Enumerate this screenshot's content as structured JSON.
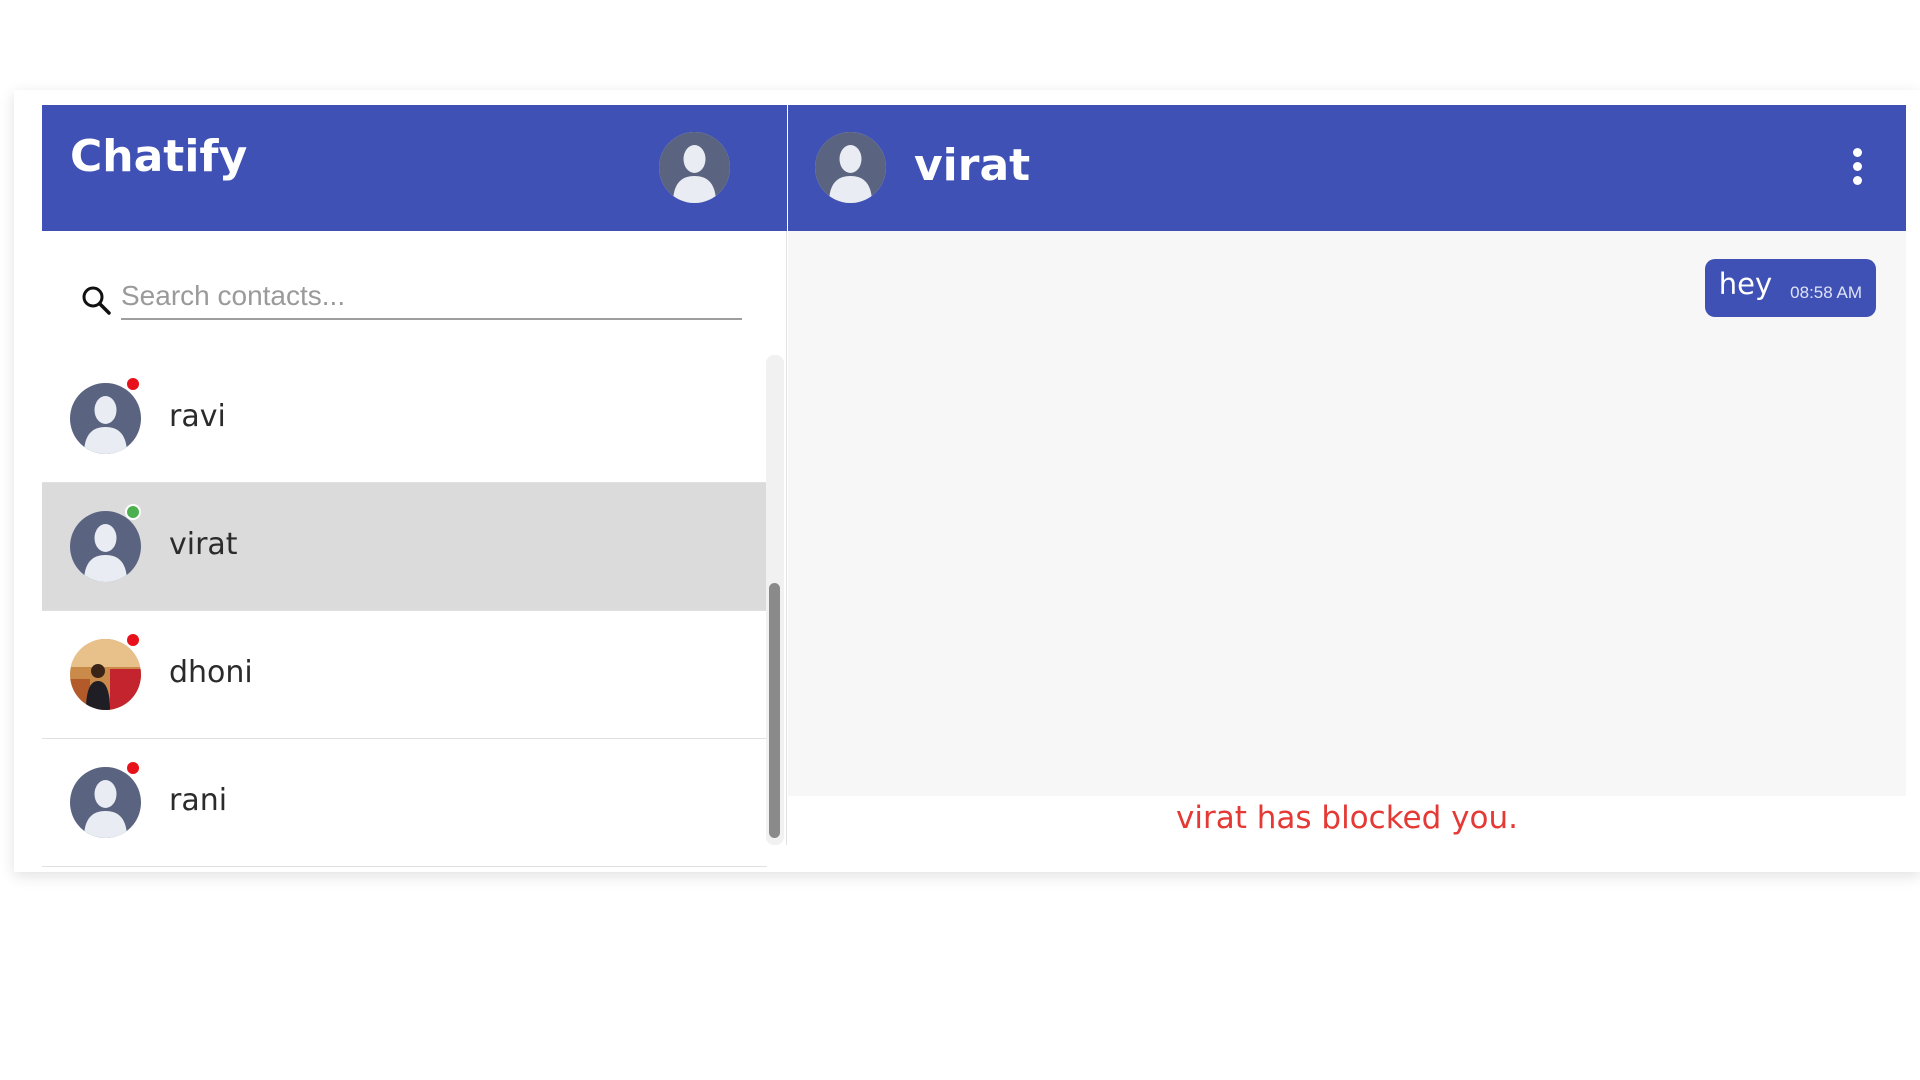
{
  "app": {
    "title": "Chatify"
  },
  "search": {
    "placeholder": "Search contacts..."
  },
  "contacts": [
    {
      "name": "ravi",
      "status": "offline",
      "status_color": "#e8101a",
      "avatar": "default-avatar",
      "active": false
    },
    {
      "name": "virat",
      "status": "online",
      "status_color": "#4caf50",
      "avatar": "default-avatar",
      "active": true
    },
    {
      "name": "dhoni",
      "status": "offline",
      "status_color": "#e8101a",
      "avatar": "photo-avatar",
      "active": false
    },
    {
      "name": "rani",
      "status": "offline",
      "status_color": "#e8101a",
      "avatar": "default-avatar",
      "active": false
    }
  ],
  "chat": {
    "contact_name": "virat",
    "messages": [
      {
        "text": "hey",
        "time": "08:58 AM",
        "direction": "outgoing"
      }
    ],
    "blocked_notice": "virat has blocked you."
  },
  "colors": {
    "primary": "#3f51b5",
    "active_row": "#dcdbdb",
    "blocked_text": "#e53935"
  },
  "icons": {
    "search": "search-icon",
    "menu": "more-vertical-icon",
    "avatar": "person-silhouette-icon"
  }
}
